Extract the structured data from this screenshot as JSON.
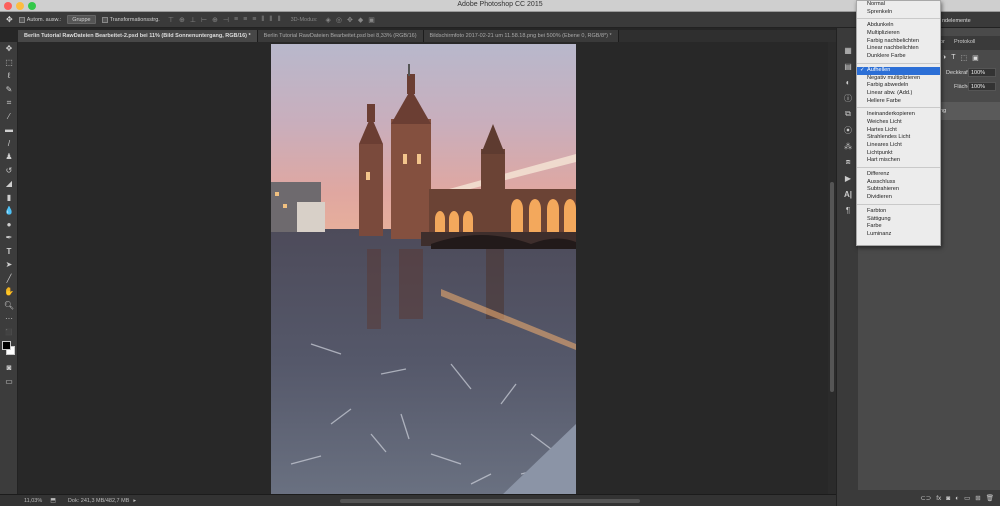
{
  "app": {
    "title": "Adobe Photoshop CC 2015"
  },
  "window_controls": {
    "close_color": "#fc605c",
    "minimize_color": "#fdbc40",
    "zoom_color": "#34c84a"
  },
  "options_bar": {
    "auto_select_label": "Autom. ausw.:",
    "auto_select_value": "Gruppe",
    "transform_label": "Transformationsstrg.",
    "mode_3d_label": "3D-Modus:"
  },
  "document_tabs": [
    {
      "label": "Berlin Tutorial RawDateien Bearbeitet-2.psd bei 11% (Bild Sonnenuntergang, RGB/16) *",
      "active": true
    },
    {
      "label": "Berlin Tutorial RawDateien Bearbeitet.psd bei 8,33% (RGB/16)",
      "active": false
    },
    {
      "label": "Bildschirmfoto 2017-02-21 um 11.58.18.png bei 500% (Ebene 0, RGB/8*) *",
      "active": false
    }
  ],
  "status_bar": {
    "zoom": "11,03%",
    "doc_info": "Dok: 241,3 MB/482,7 MB"
  },
  "layers_panel": {
    "tab_history": "Protokoll",
    "tab_partial": "or",
    "elements_partial": "ndelemente",
    "opacity_label": "Deckkraft:",
    "opacity_value": "100%",
    "fill_label": "Fläche:",
    "fill_value": "100%",
    "layer_name_partial": "ng"
  },
  "blend_menu": {
    "groups": [
      [
        "Normal",
        "Sprenkeln"
      ],
      [
        "Abdunkeln",
        "Multiplizieren",
        "Farbig nachbelichten",
        "Linear nachbelichten",
        "Dunklere Farbe"
      ],
      [
        "Aufhellen",
        "Negativ multiplizieren",
        "Farbig abwedeln",
        "Linear abw. (Add.)",
        "Hellere Farbe"
      ],
      [
        "Ineinanderkopieren",
        "Weiches Licht",
        "Hartes Licht",
        "Strahlendes Licht",
        "Lineares Licht",
        "Lichtpunkt",
        "Hart mischen"
      ],
      [
        "Differenz",
        "Ausschluss",
        "Subtrahieren",
        "Dividieren"
      ],
      [
        "Farbton",
        "Sättigung",
        "Farbe",
        "Luminanz"
      ]
    ],
    "selected": "Aufhellen",
    "selected_color": "#2c6fd6"
  },
  "tools": [
    "move-tool-icon",
    "marquee-tool-icon",
    "lasso-tool-icon",
    "quick-select-tool-icon",
    "crop-tool-icon",
    "eyedropper-tool-icon",
    "healing-brush-icon",
    "brush-tool-icon",
    "clone-stamp-icon",
    "history-brush-icon",
    "eraser-tool-icon",
    "gradient-tool-icon",
    "blur-tool-icon",
    "dodge-tool-icon",
    "pen-tool-icon",
    "type-tool-icon",
    "path-select-icon",
    "shape-tool-icon",
    "hand-tool-icon",
    "zoom-tool-icon",
    "more-tools-icon"
  ],
  "colors": {
    "menu_bg": "#ececec",
    "panel_bg": "#4a4a4a",
    "toolbar_bg": "#3c3c3c",
    "canvas_bg": "#282828"
  }
}
